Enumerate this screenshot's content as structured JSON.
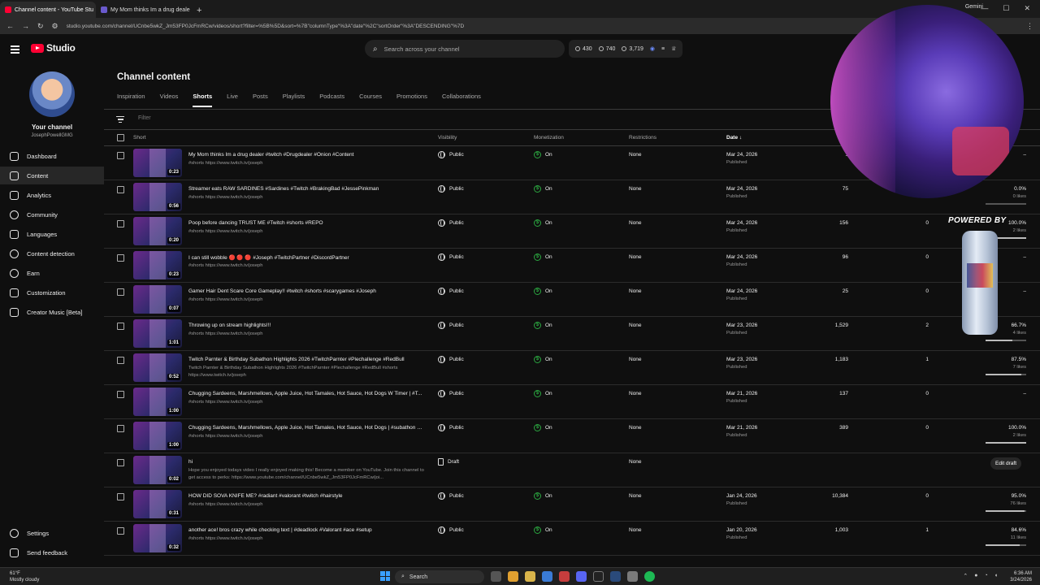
{
  "browser": {
    "tabs": [
      {
        "label": "Channel content - YouTube Stu",
        "active": true
      },
      {
        "label": "My Mom thinks Im a drug deale",
        "active": false
      }
    ],
    "new_tab": "+",
    "url": "studio.youtube.com/channel/UCnbe5wkZ_Jm53FP0JcFmRCw/videos/short?filter=%5B%5D&sort=%7B\"columnType\"%3A\"date\"%2C\"sortOrder\"%3A\"DESCENDING\"%7D",
    "gemini_label": "Gemini"
  },
  "header": {
    "logo_text": "Studio",
    "search_placeholder": "Search across your channel",
    "stats": [
      {
        "icon": "clock-icon",
        "value": "430"
      },
      {
        "icon": "eye-icon",
        "value": "740"
      },
      {
        "icon": "views-icon",
        "value": "3,719"
      }
    ]
  },
  "sidebar": {
    "channel_title": "Your channel",
    "channel_handle": "JosephPowellGMG",
    "items": [
      {
        "label": "Dashboard",
        "icon": "dashboard-icon",
        "active": false
      },
      {
        "label": "Content",
        "icon": "content-icon",
        "active": true
      },
      {
        "label": "Analytics",
        "icon": "analytics-icon",
        "active": false
      },
      {
        "label": "Community",
        "icon": "community-icon",
        "active": false
      },
      {
        "label": "Languages",
        "icon": "languages-icon",
        "active": false
      },
      {
        "label": "Content detection",
        "icon": "copyright-icon",
        "active": false
      },
      {
        "label": "Earn",
        "icon": "earn-icon",
        "active": false
      },
      {
        "label": "Customization",
        "icon": "customization-icon",
        "active": false
      },
      {
        "label": "Creator Music [Beta]",
        "icon": "music-icon",
        "active": false
      }
    ],
    "bottom": [
      {
        "label": "Settings",
        "icon": "gear-icon"
      },
      {
        "label": "Send feedback",
        "icon": "feedback-icon"
      }
    ]
  },
  "main": {
    "page_title": "Channel content",
    "tabs": [
      "Inspiration",
      "Videos",
      "Shorts",
      "Live",
      "Posts",
      "Playlists",
      "Podcasts",
      "Courses",
      "Promotions",
      "Collaborations"
    ],
    "active_tab": "Shorts",
    "filter_placeholder": "Filter",
    "columns": {
      "short": "Short",
      "visibility": "Visibility",
      "monetization": "Monetization",
      "restrictions": "Restrictions",
      "date": "Date",
      "sort_arrow": "↓"
    },
    "rows": [
      {
        "title": "My Mom thinks Im a drug dealer #twitch #Drugdealer #Onion #Content",
        "desc": "#shorts https://www.twitch.tv/joseph",
        "duration": "0:23",
        "visibility": "Public",
        "monetization": "On",
        "restrictions": "None",
        "date": "Mar 24, 2026",
        "status": "Published",
        "views": "1",
        "comments": "",
        "likes": "–",
        "likes_sub": "",
        "like_ratio": 0
      },
      {
        "title": "Streamer eats RAW SARDINES #Sardines #Twitch #BrakingBad #JessePinkman",
        "desc": "#shorts https://www.twitch.tv/joseph",
        "duration": "0:56",
        "visibility": "Public",
        "monetization": "On",
        "restrictions": "None",
        "date": "Mar 24, 2026",
        "status": "Published",
        "views": "75",
        "comments": "",
        "likes": "0.0%",
        "likes_sub": "0 likes",
        "like_ratio": 0
      },
      {
        "title": "Poop before dancing TRUST ME #Twitch #shorts #REPO",
        "desc": "#shorts https://www.twitch.tv/joseph",
        "duration": "0:20",
        "visibility": "Public",
        "monetization": "On",
        "restrictions": "None",
        "date": "Mar 24, 2026",
        "status": "Published",
        "views": "156",
        "comments": "0",
        "likes": "100.0%",
        "likes_sub": "2 likes",
        "like_ratio": 1
      },
      {
        "title": "I can still wobble 🔴 🔴 🔴 #Joseph #TwitchPartner #DiscordPartner",
        "desc": "#shorts https://www.twitch.tv/joseph",
        "duration": "0:23",
        "visibility": "Public",
        "monetization": "On",
        "restrictions": "None",
        "date": "Mar 24, 2026",
        "status": "Published",
        "views": "96",
        "comments": "0",
        "likes": "–",
        "likes_sub": "",
        "like_ratio": 0
      },
      {
        "title": "Gamer Hair Dent Scare Core Gameplay!! #twitch #shorts #scarygames #Joseph",
        "desc": "#shorts https://www.twitch.tv/joseph",
        "duration": "0:07",
        "visibility": "Public",
        "monetization": "On",
        "restrictions": "None",
        "date": "Mar 24, 2026",
        "status": "Published",
        "views": "25",
        "comments": "0",
        "likes": "–",
        "likes_sub": "",
        "like_ratio": 0
      },
      {
        "title": "Throwing up on stream highlights!!!",
        "desc": "#shorts https://www.twitch.tv/joseph",
        "duration": "1:01",
        "visibility": "Public",
        "monetization": "On",
        "restrictions": "None",
        "date": "Mar 23, 2026",
        "status": "Published",
        "views": "1,529",
        "comments": "2",
        "likes": "66.7%",
        "likes_sub": "4 likes",
        "like_ratio": 0.667
      },
      {
        "title": "Twitch Parnter & Birthday Subathon Highlights 2026 #TwitchParnter #Plechallenge #RedBull",
        "desc": "Twitch Parnter & Birthday Subathon Highlights 2026 #TwitchParnter #Plechallenge #RedBull #shorts https://www.twitch.tv/joseph",
        "duration": "0:52",
        "visibility": "Public",
        "monetization": "On",
        "restrictions": "None",
        "date": "Mar 23, 2026",
        "status": "Published",
        "views": "1,183",
        "comments": "1",
        "likes": "87.5%",
        "likes_sub": "7 likes",
        "like_ratio": 0.875
      },
      {
        "title": "Chugging Sardeens, Marshmellows, Apple Juice, Hot Tamales, Hot Sauce, Hot Dogs W Timer | #T...",
        "desc": "#shorts https://www.twitch.tv/joseph",
        "duration": "1:00",
        "visibility": "Public",
        "monetization": "On",
        "restrictions": "None",
        "date": "Mar 21, 2026",
        "status": "Published",
        "views": "137",
        "comments": "0",
        "likes": "–",
        "likes_sub": "",
        "like_ratio": 0
      },
      {
        "title": "Chugging Sardeens, Marshmellows, Apple Juice, Hot Tamales, Hot Sauce, Hot Dogs | #subathon #...",
        "desc": "#shorts https://www.twitch.tv/joseph",
        "duration": "1:00",
        "visibility": "Public",
        "monetization": "On",
        "restrictions": "None",
        "date": "Mar 21, 2026",
        "status": "Published",
        "views": "389",
        "comments": "0",
        "likes": "100.0%",
        "likes_sub": "2 likes",
        "like_ratio": 1
      },
      {
        "title": "hi",
        "desc": "Hope you enjoyed todays video I really enjoyed making this! Become a member on YouTube. Join this channel to get access to perks: https://www.youtube.com/channel/UCnbe5wkZ_Jm53FP0JcFmRCw/joi...",
        "duration": "0:02",
        "visibility": "Draft",
        "monetization": "",
        "restrictions": "None",
        "date": "",
        "status": "",
        "views": "",
        "comments": "",
        "likes": "",
        "likes_sub": "",
        "like_ratio": 0,
        "action": "Edit draft"
      },
      {
        "title": "HOW DID SOVA KNIFE ME? #radiant #valorant #twitch #hairstyle",
        "desc": "#shorts https://www.twitch.tv/joseph",
        "duration": "0:31",
        "visibility": "Public",
        "monetization": "On",
        "restrictions": "None",
        "date": "Jan 24, 2026",
        "status": "Published",
        "views": "10,384",
        "comments": "0",
        "likes": "95.0%",
        "likes_sub": "76 likes",
        "like_ratio": 0.95
      },
      {
        "title": "another ace! bros crazy while checking text | #deadlock #Valorant #ace #setup",
        "desc": "#shorts https://www.twitch.tv/joseph",
        "duration": "0:32",
        "visibility": "Public",
        "monetization": "On",
        "restrictions": "None",
        "date": "Jan 20, 2026",
        "status": "Published",
        "views": "1,003",
        "comments": "1",
        "likes": "84.6%",
        "likes_sub": "11 likes",
        "like_ratio": 0.846
      }
    ]
  },
  "overlay": {
    "powered_by": "POWERED BY"
  },
  "taskbar": {
    "weather_temp": "61°F",
    "weather_desc": "Mostly cloudy",
    "search_label": "Search",
    "time": "6:36 AM",
    "date": "3/24/2026"
  }
}
